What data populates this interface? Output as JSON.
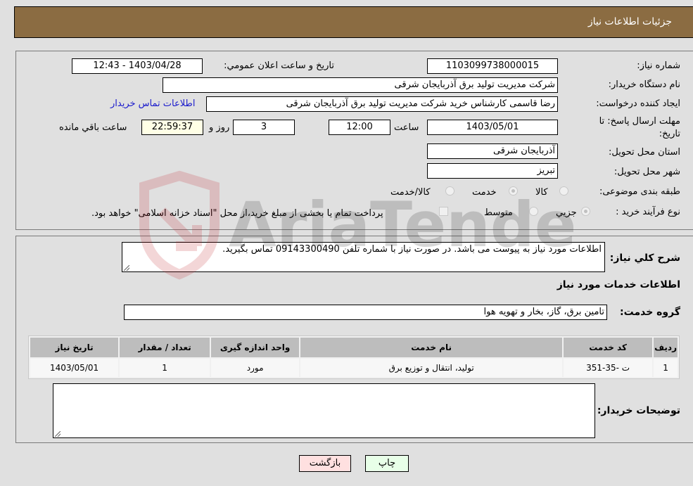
{
  "header": {
    "title": "جزئیات اطلاعات نیاز"
  },
  "form": {
    "need_number_label": "شماره نیاز:",
    "need_number": "1103099738000015",
    "announce_label": "تاریخ و ساعت اعلان عمومي:",
    "announce_value": "1403/04/28 - 12:43",
    "buyer_org_label": "نام دستگاه خریدار:",
    "buyer_org": "شرکت مدیریت تولید برق آذربایجان شرقی",
    "creator_label": "ایجاد کننده درخواست:",
    "creator": "رضا قاسمی کارشناس خرید شرکت مدیریت تولید برق آذربایجان شرقی",
    "contact_link": "اطلاعات تماس خریدار",
    "deadline_label": "مهلت ارسال پاسخ: تا تاریخ:",
    "deadline_date": "1403/05/01",
    "time_label": "ساعت",
    "deadline_time": "12:00",
    "days_value": "3",
    "days_label": "روز و",
    "remaining_time": "22:59:37",
    "remaining_label": "ساعت باقي مانده",
    "province_label": "استان محل تحویل:",
    "province": "آذربایجان شرقی",
    "city_label": "شهر محل تحویل:",
    "city": "تبریز",
    "category_label": "طبقه بندی موضوعی:",
    "category_options": [
      {
        "label": "کالا",
        "checked": false
      },
      {
        "label": "خدمت",
        "checked": true
      },
      {
        "label": "کالا/خدمت",
        "checked": false
      }
    ],
    "process_label": "نوع فرآیند خرید :",
    "process_options": [
      {
        "label": "جزیي",
        "checked": true
      },
      {
        "label": "متوسط",
        "checked": false
      }
    ],
    "treasury_note": "پرداخت تمام یا بخشی از مبلغ خرید،از محل \"اسناد خزانه اسلامی\" خواهد بود."
  },
  "details": {
    "description_label": "شرح کلي نیاز:",
    "description": "اطلاعات مورد نیاز به پیوست می باشد. در صورت نیاز با شماره تلفن 09143300490 تماس بگیرید.",
    "services_heading": "اطلاعات خدمات مورد نیاز",
    "service_group_label": "گروه خدمت:",
    "service_group": "تامین برق، گاز، بخار و تهویه هوا",
    "table": {
      "headers": [
        "ردیف",
        "کد خدمت",
        "نام خدمت",
        "واحد اندازه گیری",
        "تعداد / مقدار",
        "تاریخ نیاز"
      ],
      "rows": [
        [
          "1",
          "ت -35-351",
          "تولید، انتقال و توزیع برق",
          "مورد",
          "1",
          "1403/05/01"
        ]
      ]
    },
    "buyer_notes_label": "توضیحات خریدار:",
    "buyer_notes": ""
  },
  "buttons": {
    "print": "چاپ",
    "back": "بازگشت"
  },
  "watermark": {
    "text": "AriaTender.neT"
  }
}
